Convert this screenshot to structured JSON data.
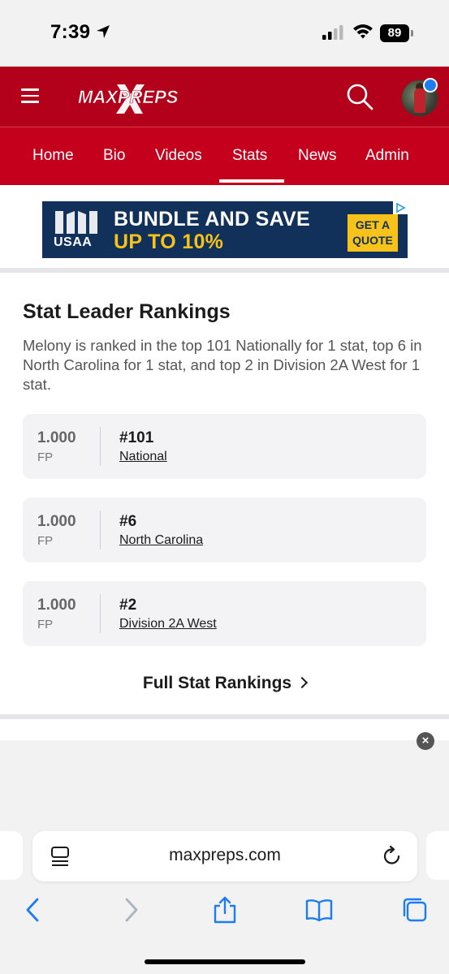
{
  "status_bar": {
    "time": "7:39",
    "battery": "89"
  },
  "header": {
    "logo_text": "MAXPREPS"
  },
  "nav": {
    "tabs": [
      {
        "label": "Home"
      },
      {
        "label": "Bio"
      },
      {
        "label": "Videos"
      },
      {
        "label": "Stats",
        "active": true
      },
      {
        "label": "News"
      },
      {
        "label": "Admin"
      }
    ]
  },
  "ad": {
    "brand": "USAA",
    "line1": "BUNDLE AND SAVE",
    "line2": "UP TO 10%",
    "cta_line1": "GET A",
    "cta_line2": "QUOTE"
  },
  "stat_leader": {
    "title": "Stat Leader Rankings",
    "description": "Melony is ranked in the top 101 Nationally for 1 stat, top 6 in North Carolina for 1 stat, and top 2 in Division 2A West for 1 stat.",
    "rankings": [
      {
        "value": "1.000",
        "stat": "FP",
        "rank": "#101",
        "scope": "National"
      },
      {
        "value": "1.000",
        "stat": "FP",
        "rank": "#6",
        "scope": "North Carolina"
      },
      {
        "value": "1.000",
        "stat": "FP",
        "rank": "#2",
        "scope": "Division 2A West"
      }
    ],
    "full_link": "Full Stat Rankings"
  },
  "browser": {
    "url": "maxpreps.com"
  },
  "colors": {
    "brand_red": "#b3001b",
    "ad_navy": "#12315a",
    "ad_yellow": "#f7c21a",
    "ios_blue": "#1d7cf2"
  }
}
